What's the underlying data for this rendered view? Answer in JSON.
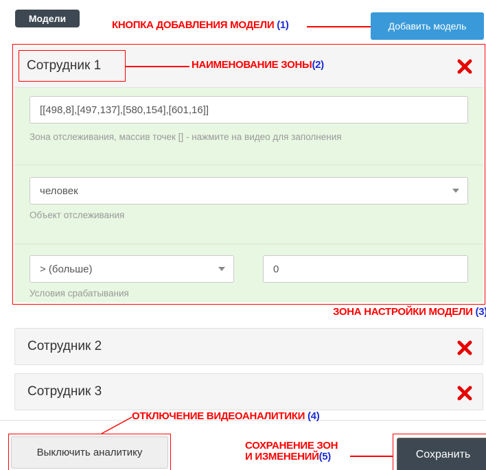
{
  "header": {
    "models_label": "Модели",
    "add_model_label": "Добавить модель"
  },
  "annotations": {
    "a1_text": "КНОПКА ДОБАВЛЕНИЯ МОДЕЛИ",
    "a1_num": "(1)",
    "a2_text": "НАИМЕНОВАНИЕ ЗОНЫ",
    "a2_num": "(2)",
    "a3_text": "ЗОНА НАСТРОЙКИ МОДЕЛИ",
    "a3_num": "(3)",
    "a4_text": "ОТКЛЮЧЕНИЕ ВИДЕОАНАЛИТИКИ",
    "a4_num": "(4)",
    "a5_line1": "СОХРАНЕНИЕ ЗОН",
    "a5_line2": "И ИЗМЕНЕНИЙ",
    "a5_num": "(5)",
    "color_red": "#ff0000",
    "color_blue": "#1a2bd6"
  },
  "zones": [
    {
      "name": "Сотрудник 1",
      "expanded": true,
      "points_value": "[[498,8],[497,137],[580,154],[601,16]]",
      "points_help": "Зона отслеживания, массив точек [] - нажмите на видео для заполнения",
      "object_value": "человек",
      "object_help": "Объект отслеживания",
      "condition_value": "> (больше)",
      "condition_number": "0",
      "condition_help": "Условия срабатывания"
    },
    {
      "name": "Сотрудник 2",
      "expanded": false
    },
    {
      "name": "Сотрудник 3",
      "expanded": false
    }
  ],
  "footer": {
    "disable_label": "Выключить аналитику",
    "save_label": "Сохранить"
  },
  "icons": {
    "delete": "close-x-icon"
  },
  "colors": {
    "accent": "#3a9ad9",
    "dark": "#3d4852",
    "settings_bg": "#e8f7e2",
    "delete": "#e60000"
  }
}
